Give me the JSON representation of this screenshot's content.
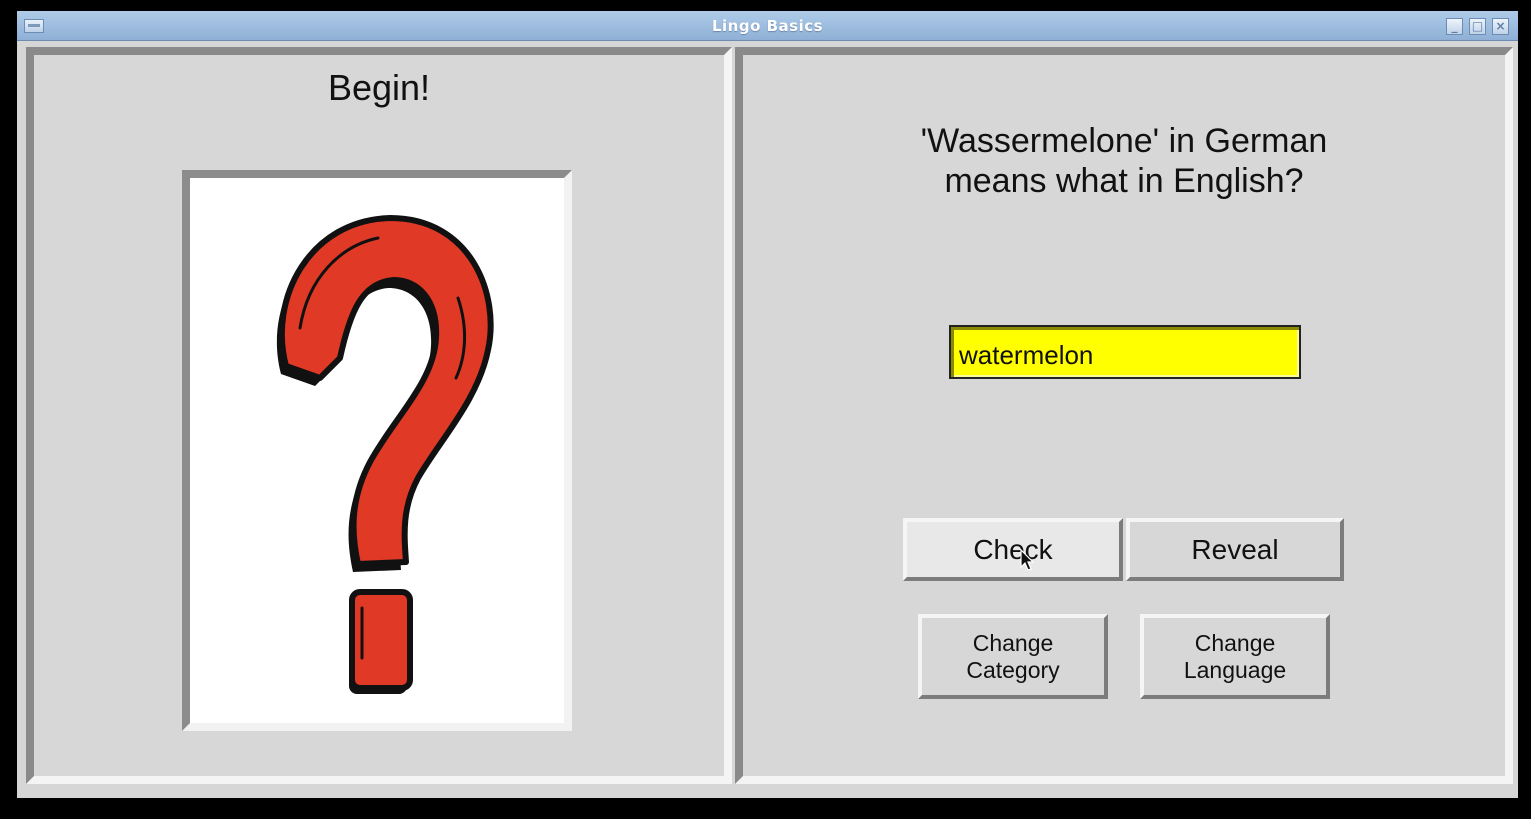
{
  "window": {
    "title": "Lingo Basics"
  },
  "left_panel": {
    "heading": "Begin!",
    "image_icon": "question-mark-icon"
  },
  "right_panel": {
    "question_line1": "'Wassermelone' in German",
    "question_line2": "means what in English?",
    "answer_value": "watermelon",
    "answer_bg": "#ffff00",
    "buttons": {
      "check": "Check",
      "reveal": "Reveal",
      "change_category_1": "Change",
      "change_category_2": "Category",
      "change_language_1": "Change",
      "change_language_2": "Language"
    }
  },
  "colors": {
    "question_mark_red": "#e03a26",
    "titlebar": "#9dbde0"
  }
}
